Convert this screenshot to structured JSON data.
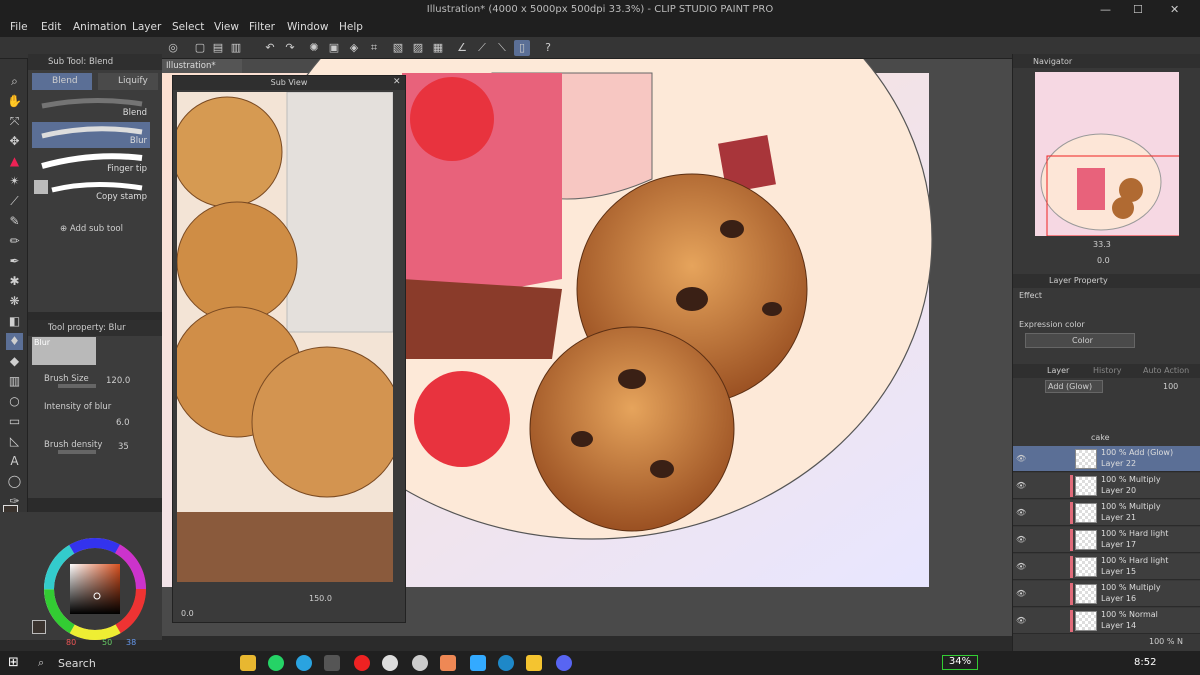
{
  "window": {
    "title": "Illustration* (4000 x 5000px 500dpi 33.3%) - CLIP STUDIO PAINT PRO",
    "minimize": "—",
    "maximize": "☐",
    "close": "✕"
  },
  "menu": [
    "File",
    "Edit",
    "Animation",
    "Layer",
    "Select",
    "View",
    "Filter",
    "Window",
    "Help"
  ],
  "subtool": {
    "panel_title": "Sub Tool: Blend",
    "tabs": [
      "Blend",
      "Liquify"
    ],
    "items": [
      "Blend",
      "Blur",
      "Finger tip",
      "Copy stamp"
    ],
    "add_label": "Add sub tool"
  },
  "toolprop": {
    "panel_title": "Tool property: Blur",
    "preview_label": "Blur",
    "brush_size_label": "Brush Size",
    "brush_size_value": "120.0",
    "intensity_label": "Intensity of blur",
    "intensity_value": "6.0",
    "density_label": "Brush density",
    "density_value": "35"
  },
  "color": {
    "r": "80",
    "g": "50",
    "b": "38"
  },
  "document": {
    "tab": "Illustration*"
  },
  "subview": {
    "title": "Sub View",
    "zoom": "150.0",
    "angle": "0.0"
  },
  "navigator": {
    "title": "Navigator",
    "zoom": "33.3",
    "angle": "0.0"
  },
  "layer_property": {
    "title": "Layer Property",
    "effect_label": "Effect",
    "expression_label": "Expression color",
    "expression_value": "Color"
  },
  "layer_panel": {
    "tabs": [
      "Layer",
      "History",
      "Auto Action"
    ],
    "blend_mode": "Add (Glow)",
    "opacity": "100",
    "folder_name": "cake",
    "layers": [
      {
        "mode": "100 % Add (Glow)",
        "name": "Layer 22",
        "selected": true
      },
      {
        "mode": "100 % Multiply",
        "name": "Layer 20"
      },
      {
        "mode": "100 % Multiply",
        "name": "Layer 21"
      },
      {
        "mode": "100 % Hard light",
        "name": "Layer 17"
      },
      {
        "mode": "100 % Hard light",
        "name": "Layer 15"
      },
      {
        "mode": "100 % Multiply",
        "name": "Layer 16"
      },
      {
        "mode": "100 % Normal",
        "name": "Layer 14"
      }
    ],
    "last_row_mode": "100 % N"
  },
  "taskbar": {
    "search_label": "Search",
    "battery": "34%",
    "time": "8:52"
  },
  "colors": {
    "accent": "#5b6f96",
    "panel": "#383838",
    "canvas_bg": "#fde6d7"
  }
}
